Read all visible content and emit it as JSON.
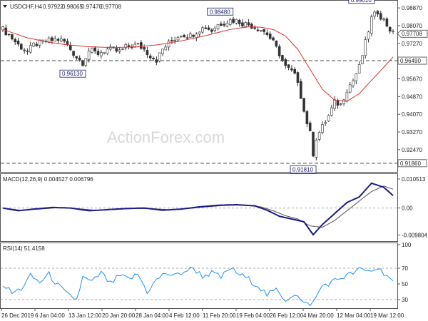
{
  "chart_data": [
    {
      "type": "candlestick",
      "header": {
        "symbol": "USDCHF,H4",
        "ohlc": [
          "0.97922",
          "0.98065",
          "0.97470",
          "0.97708"
        ]
      },
      "watermark": "ActionForex.com",
      "y_range": [
        0.915,
        0.991
      ],
      "y_ticks": [
        "0.98870",
        "0.98070",
        "0.97270",
        "0.96470",
        "0.95670",
        "0.94870",
        "0.94070",
        "0.93270",
        "0.92470"
      ],
      "x_ticks": [
        "26 Dec 2019",
        "6 Jan 04:00",
        "13 Jan 12:00",
        "20 Jan 20:00",
        "28 Jan 04:00",
        "4 Feb 12:00",
        "11 Feb 20:00",
        "19 Feb 04:00",
        "26 Feb 12:00",
        "4 Mar 20:00",
        "12 Mar 04:00",
        "19 Mar 12:00"
      ],
      "current_price": "0.97708",
      "hlines": [
        {
          "value": 0.9649,
          "label": "0.96490"
        },
        {
          "value": 0.9186,
          "label": "0.91860"
        }
      ],
      "annotations": [
        {
          "label": "0.96130",
          "value": 0.9613,
          "index": 26
        },
        {
          "label": "0.98480",
          "value": 0.9848,
          "index": 74
        },
        {
          "label": "0.91810",
          "value": 0.9181,
          "index": 101
        },
        {
          "label": "0.99010",
          "value": 0.9901,
          "index": 120
        }
      ],
      "anchors": [
        [
          0,
          0.979
        ],
        [
          2,
          0.9765
        ],
        [
          5,
          0.972
        ],
        [
          8,
          0.969
        ],
        [
          10,
          0.972
        ],
        [
          14,
          0.9738
        ],
        [
          18,
          0.9745
        ],
        [
          20,
          0.9735
        ],
        [
          24,
          0.9665
        ],
        [
          26,
          0.964
        ],
        [
          28,
          0.9695
        ],
        [
          31,
          0.9682
        ],
        [
          34,
          0.97
        ],
        [
          38,
          0.969
        ],
        [
          40,
          0.971
        ],
        [
          44,
          0.972
        ],
        [
          46,
          0.97
        ],
        [
          48,
          0.9672
        ],
        [
          50,
          0.9652
        ],
        [
          52,
          0.97
        ],
        [
          55,
          0.974
        ],
        [
          58,
          0.9768
        ],
        [
          61,
          0.9762
        ],
        [
          64,
          0.979
        ],
        [
          66,
          0.98
        ],
        [
          68,
          0.9785
        ],
        [
          70,
          0.9812
        ],
        [
          72,
          0.9822
        ],
        [
          74,
          0.9832
        ],
        [
          76,
          0.983
        ],
        [
          78,
          0.9818
        ],
        [
          80,
          0.9812
        ],
        [
          82,
          0.98
        ],
        [
          84,
          0.979
        ],
        [
          86,
          0.977
        ],
        [
          88,
          0.973
        ],
        [
          90,
          0.968
        ],
        [
          92,
          0.962
        ],
        [
          94,
          0.96
        ],
        [
          96,
          0.956
        ],
        [
          98,
          0.942
        ],
        [
          100,
          0.932
        ],
        [
          101,
          0.923
        ],
        [
          102,
          0.93
        ],
        [
          104,
          0.935
        ],
        [
          106,
          0.94
        ],
        [
          108,
          0.946
        ],
        [
          110,
          0.945
        ],
        [
          112,
          0.952
        ],
        [
          114,
          0.956
        ],
        [
          116,
          0.962
        ],
        [
          118,
          0.973
        ],
        [
          120,
          0.984
        ],
        [
          122,
          0.987
        ],
        [
          124,
          0.983
        ],
        [
          126,
          0.979
        ],
        [
          127,
          0.9771
        ]
      ],
      "sma_anchors": [
        [
          0,
          0.979
        ],
        [
          8,
          0.9752
        ],
        [
          14,
          0.9735
        ],
        [
          20,
          0.9722
        ],
        [
          28,
          0.9712
        ],
        [
          36,
          0.9708
        ],
        [
          44,
          0.9712
        ],
        [
          50,
          0.972
        ],
        [
          58,
          0.9738
        ],
        [
          66,
          0.9762
        ],
        [
          74,
          0.979
        ],
        [
          80,
          0.9802
        ],
        [
          84,
          0.98
        ],
        [
          88,
          0.979
        ],
        [
          92,
          0.976
        ],
        [
          96,
          0.97
        ],
        [
          100,
          0.961
        ],
        [
          104,
          0.952
        ],
        [
          108,
          0.947
        ],
        [
          112,
          0.9465
        ],
        [
          116,
          0.95
        ],
        [
          120,
          0.956
        ],
        [
          124,
          0.962
        ],
        [
          127,
          0.9665
        ]
      ]
    },
    {
      "type": "line",
      "label": "MACD(12,26,9) 0.004527 0.006796",
      "y_range": [
        -0.0115,
        0.0118
      ],
      "y_ticks": [
        "0.010513",
        "0.00",
        "-0.009804"
      ],
      "macd_anchors": [
        [
          0,
          0.0
        ],
        [
          5,
          -0.001
        ],
        [
          10,
          -0.0004
        ],
        [
          16,
          0.0002
        ],
        [
          22,
          0.0
        ],
        [
          28,
          -0.001
        ],
        [
          34,
          -0.0006
        ],
        [
          40,
          -0.0002
        ],
        [
          46,
          0.0
        ],
        [
          52,
          -0.0008
        ],
        [
          58,
          -0.0004
        ],
        [
          64,
          0.0004
        ],
        [
          70,
          0.001
        ],
        [
          76,
          0.0012
        ],
        [
          82,
          0.0008
        ],
        [
          86,
          -0.0008
        ],
        [
          90,
          -0.003
        ],
        [
          94,
          -0.004
        ],
        [
          98,
          -0.005
        ],
        [
          101,
          -0.0097
        ],
        [
          104,
          -0.006
        ],
        [
          108,
          -0.002
        ],
        [
          112,
          0.002
        ],
        [
          116,
          0.004
        ],
        [
          120,
          0.009
        ],
        [
          124,
          0.0075
        ],
        [
          127,
          0.0045
        ]
      ],
      "signal_anchors": [
        [
          0,
          0.0
        ],
        [
          6,
          -0.0008
        ],
        [
          12,
          -0.0004
        ],
        [
          18,
          0.0001
        ],
        [
          24,
          -0.0002
        ],
        [
          30,
          -0.0008
        ],
        [
          36,
          -0.0006
        ],
        [
          42,
          -0.0002
        ],
        [
          48,
          -0.0002
        ],
        [
          54,
          -0.0006
        ],
        [
          60,
          -0.0002
        ],
        [
          66,
          0.0004
        ],
        [
          72,
          0.0009
        ],
        [
          78,
          0.0011
        ],
        [
          84,
          0.0004
        ],
        [
          88,
          -0.001
        ],
        [
          92,
          -0.0028
        ],
        [
          96,
          -0.004
        ],
        [
          100,
          -0.0065
        ],
        [
          104,
          -0.007
        ],
        [
          108,
          -0.0045
        ],
        [
          112,
          -0.001
        ],
        [
          116,
          0.0025
        ],
        [
          120,
          0.006
        ],
        [
          124,
          0.008
        ],
        [
          127,
          0.0068
        ]
      ]
    },
    {
      "type": "line",
      "label": "RSI(14) 51.4158",
      "y_range": [
        20,
        100
      ],
      "y_ticks": [
        "100",
        "70",
        "50",
        "30"
      ],
      "levels": [
        70,
        30
      ],
      "rsi_anchors": [
        [
          0,
          50
        ],
        [
          3,
          38
        ],
        [
          6,
          44
        ],
        [
          9,
          60
        ],
        [
          12,
          52
        ],
        [
          15,
          62
        ],
        [
          18,
          48
        ],
        [
          21,
          36
        ],
        [
          24,
          30
        ],
        [
          26,
          58
        ],
        [
          29,
          52
        ],
        [
          32,
          64
        ],
        [
          35,
          50
        ],
        [
          38,
          60
        ],
        [
          41,
          56
        ],
        [
          44,
          62
        ],
        [
          47,
          40
        ],
        [
          50,
          55
        ],
        [
          53,
          64
        ],
        [
          56,
          60
        ],
        [
          59,
          66
        ],
        [
          62,
          70
        ],
        [
          65,
          60
        ],
        [
          68,
          64
        ],
        [
          71,
          58
        ],
        [
          74,
          70
        ],
        [
          77,
          62
        ],
        [
          80,
          56
        ],
        [
          83,
          48
        ],
        [
          86,
          36
        ],
        [
          89,
          42
        ],
        [
          92,
          30
        ],
        [
          95,
          38
        ],
        [
          98,
          24
        ],
        [
          101,
          26
        ],
        [
          104,
          48
        ],
        [
          107,
          52
        ],
        [
          110,
          58
        ],
        [
          113,
          62
        ],
        [
          116,
          68
        ],
        [
          119,
          66
        ],
        [
          122,
          70
        ],
        [
          125,
          62
        ],
        [
          127,
          51
        ]
      ]
    }
  ]
}
